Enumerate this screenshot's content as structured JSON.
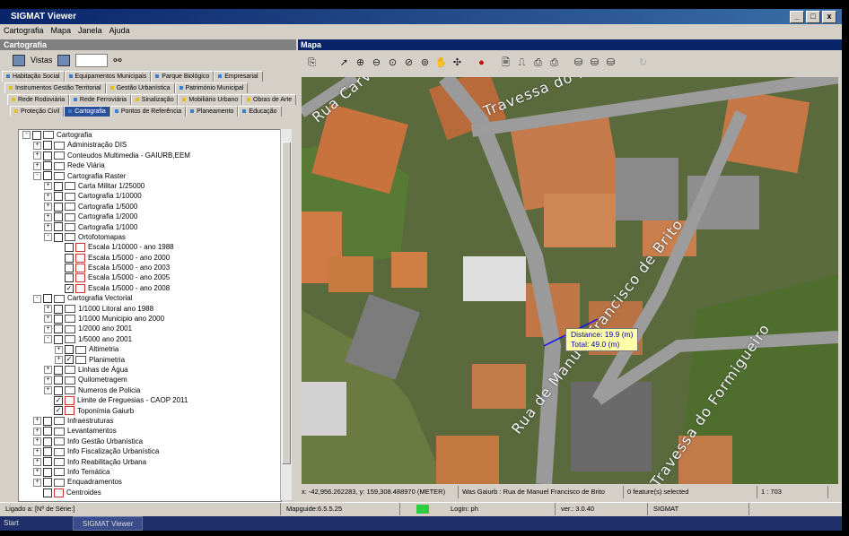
{
  "window": {
    "title": "SIGMAT Viewer",
    "controls": [
      "_",
      "□",
      "x"
    ]
  },
  "menu": [
    "Cartografia",
    "Mapa",
    "Janela",
    "Ajuda"
  ],
  "left_panel": {
    "header": "Cartografia",
    "views_label": "Vistas",
    "tab_rows": [
      [
        {
          "label": "Habitação Social",
          "color": "#3b7fd0"
        },
        {
          "label": "Equipamentos Municipais",
          "color": "#3b7fd0"
        },
        {
          "label": "Parque Biológico",
          "color": "#3b7fd0"
        },
        {
          "label": "Empresarial",
          "color": "#3b7fd0"
        }
      ],
      [
        {
          "label": "Instrumentos Gestão Territorial",
          "color": "#e0c020"
        },
        {
          "label": "Gestão Urbanística",
          "color": "#e0c020"
        },
        {
          "label": "Património Municipal",
          "color": "#3b7fd0"
        }
      ],
      [
        {
          "label": "Rede Rodoviária",
          "color": "#e0c020"
        },
        {
          "label": "Rede Ferroviária",
          "color": "#3b7fd0"
        },
        {
          "label": "Sinalização",
          "color": "#e0c020"
        },
        {
          "label": "Mobiliário Urbano",
          "color": "#e0c020"
        },
        {
          "label": "Obras de Arte",
          "color": "#e0c020"
        }
      ],
      [
        {
          "label": "Proteção Civil",
          "color": "#e0c020"
        },
        {
          "label": "Cartografia",
          "color": "#3b7fd0",
          "active": true
        },
        {
          "label": "Pontos de Referência",
          "color": "#3b7fd0"
        },
        {
          "label": "Planeamento",
          "color": "#3b7fd0"
        },
        {
          "label": "Educação",
          "color": "#3b7fd0"
        }
      ]
    ],
    "tree": [
      {
        "label": "Cartografia",
        "level": 0,
        "expander": "-",
        "checked": false,
        "icon": "folder"
      },
      {
        "label": "Administração DIS",
        "level": 1,
        "expander": "+",
        "checked": false,
        "icon": "folder"
      },
      {
        "label": "Conteudos Multimedia - GAIURB,EEM",
        "level": 1,
        "expander": "+",
        "checked": false,
        "icon": "folder"
      },
      {
        "label": "Rede Viária",
        "level": 1,
        "expander": "+",
        "checked": false,
        "icon": "folder"
      },
      {
        "label": "Cartografia Raster",
        "level": 1,
        "expander": "-",
        "checked": false,
        "icon": "folder"
      },
      {
        "label": "Carta Militar 1/25000",
        "level": 2,
        "expander": "+",
        "checked": false,
        "icon": "folder"
      },
      {
        "label": "Cartografia 1/10000",
        "level": 2,
        "expander": "+",
        "checked": false,
        "icon": "folder"
      },
      {
        "label": "Cartografia 1/5000",
        "level": 2,
        "expander": "+",
        "checked": false,
        "icon": "folder"
      },
      {
        "label": "Cartografia 1/2000",
        "level": 2,
        "expander": "+",
        "checked": false,
        "icon": "folder"
      },
      {
        "label": "Cartografia 1/1000",
        "level": 2,
        "expander": "+",
        "checked": false,
        "icon": "folder"
      },
      {
        "label": "Ortofotomapas",
        "level": 2,
        "expander": "-",
        "checked": false,
        "icon": "folder"
      },
      {
        "label": "Escala 1/10000 - ano 1988",
        "level": 3,
        "expander": "",
        "checked": false,
        "icon": "layer"
      },
      {
        "label": "Escala 1/5000 - ano 2000",
        "level": 3,
        "expander": "",
        "checked": false,
        "icon": "layer"
      },
      {
        "label": "Escala 1/5000 - ano 2003",
        "level": 3,
        "expander": "",
        "checked": false,
        "icon": "layer"
      },
      {
        "label": "Escala 1/5000 - ano 2005",
        "level": 3,
        "expander": "",
        "checked": false,
        "icon": "layer"
      },
      {
        "label": "Escala 1/5000 - ano 2008",
        "level": 3,
        "expander": "",
        "checked": true,
        "icon": "layer"
      },
      {
        "label": "Cartografia Vectorial",
        "level": 1,
        "expander": "-",
        "checked": false,
        "icon": "folder"
      },
      {
        "label": "1/1000 Litoral ano 1988",
        "level": 2,
        "expander": "+",
        "checked": false,
        "icon": "folder"
      },
      {
        "label": "1/1000 Municipio ano 2000",
        "level": 2,
        "expander": "+",
        "checked": false,
        "icon": "folder"
      },
      {
        "label": "1/2000 ano 2001",
        "level": 2,
        "expander": "+",
        "checked": false,
        "icon": "folder"
      },
      {
        "label": "1/5000 ano 2001",
        "level": 2,
        "expander": "-",
        "checked": false,
        "icon": "folder"
      },
      {
        "label": "Altimetria",
        "level": 3,
        "expander": "+",
        "checked": false,
        "icon": "folder"
      },
      {
        "label": "Planimetria",
        "level": 3,
        "expander": "+",
        "checked": true,
        "icon": "folder"
      },
      {
        "label": "Linhas de Água",
        "level": 2,
        "expander": "+",
        "checked": false,
        "icon": "folder"
      },
      {
        "label": "Quilometragem",
        "level": 2,
        "expander": "+",
        "checked": false,
        "icon": "folder"
      },
      {
        "label": "Numeros de Policia",
        "level": 2,
        "expander": "+",
        "checked": false,
        "icon": "folder"
      },
      {
        "label": "Limite de Freguesias - CAOP 2011",
        "level": 2,
        "expander": "",
        "checked": true,
        "icon": "layer"
      },
      {
        "label": "Toponímia Gaiurb",
        "level": 2,
        "expander": "",
        "checked": true,
        "icon": "layer"
      },
      {
        "label": "Infraestruturas",
        "level": 1,
        "expander": "+",
        "checked": false,
        "icon": "folder"
      },
      {
        "label": "Levantamentos",
        "level": 1,
        "expander": "+",
        "checked": false,
        "icon": "folder"
      },
      {
        "label": "Info Gestão Urbanística",
        "level": 1,
        "expander": "+",
        "checked": false,
        "icon": "folder"
      },
      {
        "label": "Info Fiscalização Urbanística",
        "level": 1,
        "expander": "+",
        "checked": false,
        "icon": "folder"
      },
      {
        "label": "Info Reabilitação Urbana",
        "level": 1,
        "expander": "+",
        "checked": false,
        "icon": "folder"
      },
      {
        "label": "Info Temática",
        "level": 1,
        "expander": "+",
        "checked": false,
        "icon": "folder"
      },
      {
        "label": "Enquadramentos",
        "level": 1,
        "expander": "+",
        "checked": false,
        "icon": "folder"
      },
      {
        "label": "Centroides",
        "level": 1,
        "expander": "",
        "checked": false,
        "icon": "layer"
      }
    ]
  },
  "map_panel": {
    "header": "Mapa",
    "measure": {
      "distance": "Distance: 19.9 (m)",
      "total": "Total: 49.0 (m)"
    },
    "streets": [
      "Travessa do Marmoiral",
      "Rua de Manuel Francisco de Brito",
      "Travessa do Formigueiro",
      "Rua Carvalho"
    ],
    "status": {
      "coords": "x: -42,956.262283, y: 159,308.488970 (METER)",
      "location": "Was Gaiurb : Rua de Manuel Francisco de Brito",
      "selection": "0 feature(s) selected",
      "scale": "1 : 703"
    }
  },
  "statusbar": {
    "left": "Ligado a:  [Nº de Série:]",
    "mapguide": "Mapguide:6.5.5.25",
    "login": "Login: ph",
    "version": "ver.: 3.0.40",
    "app": "SIGMAT"
  },
  "taskbar": {
    "start": "Start",
    "task": "SIGMAT Viewer"
  }
}
